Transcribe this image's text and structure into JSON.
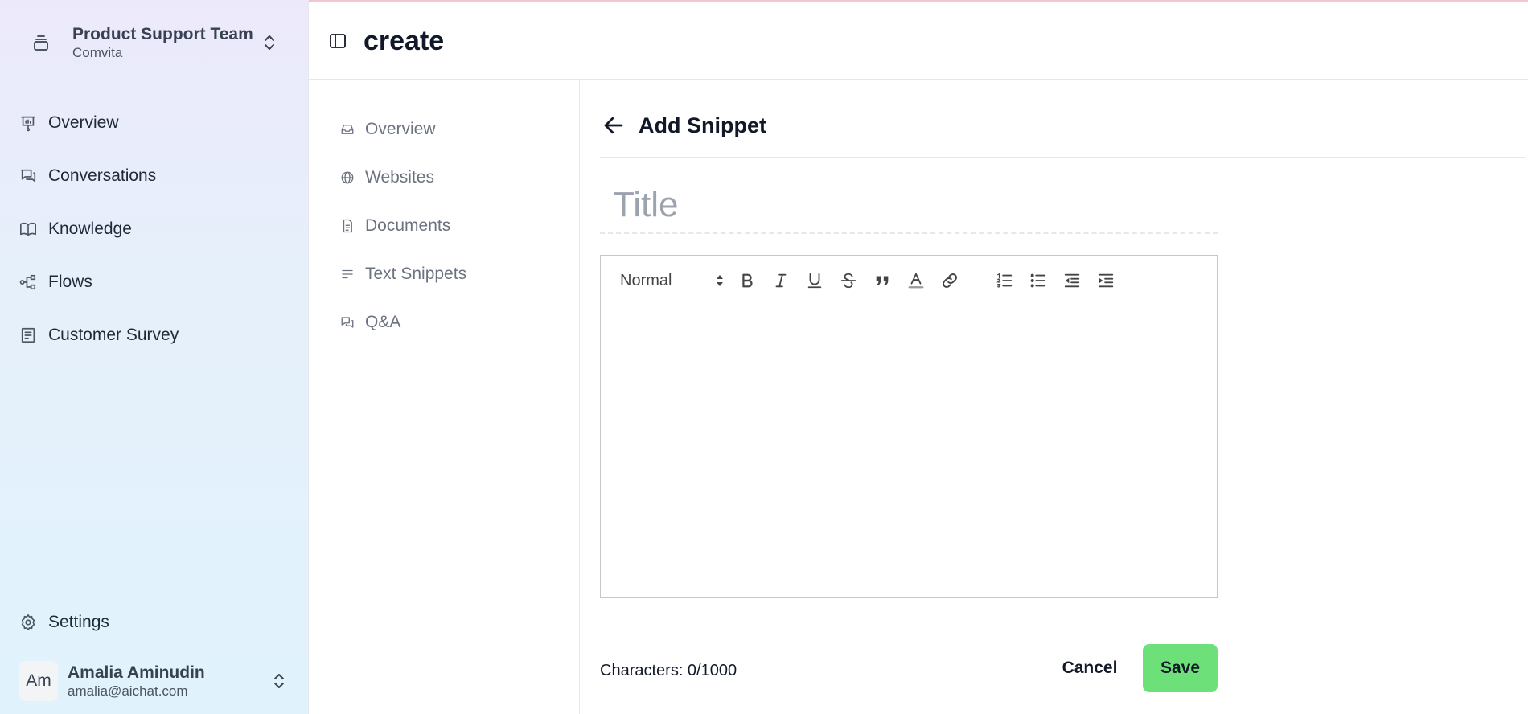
{
  "team": {
    "name": "Product Support Team",
    "org": "Comvita",
    "icon": "stack-icon",
    "switch_icon": "chevron-up-down-icon"
  },
  "nav": {
    "items": [
      {
        "label": "Overview",
        "icon": "presentation-icon"
      },
      {
        "label": "Conversations",
        "icon": "chat-bubbles-icon"
      },
      {
        "label": "Knowledge",
        "icon": "book-icon"
      },
      {
        "label": "Flows",
        "icon": "flow-icon"
      },
      {
        "label": "Customer Survey",
        "icon": "survey-icon"
      }
    ],
    "settings_label": "Settings"
  },
  "user": {
    "initials": "Am",
    "name": "Amalia Aminudin",
    "email": "amalia@aichat.com"
  },
  "header": {
    "title": "create"
  },
  "subnav": {
    "items": [
      {
        "label": "Overview",
        "icon": "inbox-icon"
      },
      {
        "label": "Websites",
        "icon": "globe-icon"
      },
      {
        "label": "Documents",
        "icon": "document-icon"
      },
      {
        "label": "Text Snippets",
        "icon": "text-lines-icon"
      },
      {
        "label": "Q&A",
        "icon": "qa-chat-icon"
      }
    ]
  },
  "main": {
    "section_title": "Add Snippet",
    "title_placeholder": "Title",
    "editor": {
      "format_value": "Normal"
    },
    "characters_label": "Characters: 0/1000",
    "cancel_label": "Cancel",
    "save_label": "Save"
  },
  "colors": {
    "save_button": "#6ee07a",
    "sidebar_top": "#ece9fb",
    "sidebar_bottom": "#e0f3fc",
    "muted_text": "#6b7280"
  }
}
